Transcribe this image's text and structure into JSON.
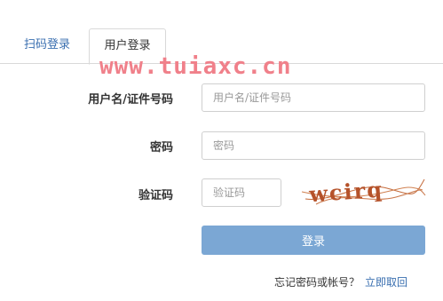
{
  "tabs": {
    "qr_login": "扫码登录",
    "user_login": "用户登录"
  },
  "watermark": "www.tuiaxc.cn",
  "form": {
    "username_label": "用户名/证件号码",
    "username_placeholder": "用户名/证件号码",
    "password_label": "密码",
    "password_placeholder": "密码",
    "captcha_label": "验证码",
    "captcha_placeholder": "验证码",
    "captcha_text": "wcirq"
  },
  "login_button": "登录",
  "forgot": {
    "prompt": "忘记密码或帐号？",
    "link": "立即取回"
  },
  "colors": {
    "accent": "#3a6fb0",
    "button": "#7ba7d4",
    "watermark": "#f0808a",
    "captcha": "#b5522a"
  }
}
